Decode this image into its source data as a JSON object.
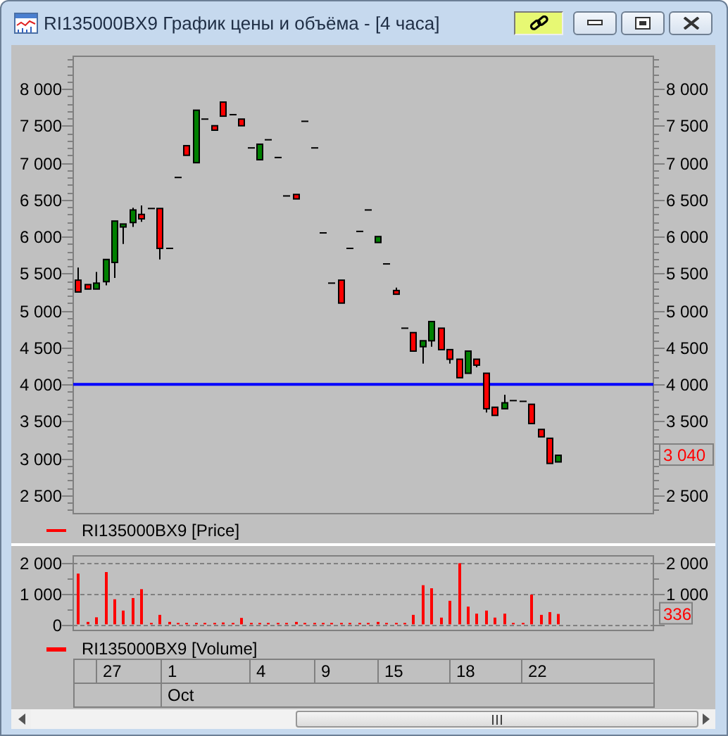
{
  "window": {
    "title": "RI135000BX9 График цены и объёма - [4 часа]"
  },
  "price_panel": {
    "legend": "RI135000BX9 [Price]",
    "last_value": "3 040",
    "chart_data": {
      "type": "candlestick",
      "categories": [
        null,
        null,
        null,
        null,
        null,
        null,
        null,
        null,
        null,
        null,
        null,
        null,
        null,
        null,
        null,
        null,
        null,
        null,
        null,
        null,
        null,
        null,
        null,
        null,
        null,
        null,
        null,
        null,
        null,
        null,
        null,
        null,
        null,
        null,
        null,
        null,
        null,
        null,
        null,
        null,
        null,
        null,
        null,
        null,
        null,
        null,
        null,
        null,
        null,
        null,
        null,
        null,
        null,
        null,
        null,
        null,
        null,
        null,
        null,
        null,
        null,
        null,
        null,
        null
      ],
      "ylim": [
        2250,
        8440
      ],
      "yticks": [
        {
          "value": 2500,
          "label": "2 500"
        },
        {
          "value": 3000,
          "label": "3 000"
        },
        {
          "value": 3500,
          "label": "3 500"
        },
        {
          "value": 4000,
          "label": "4 000"
        },
        {
          "value": 4500,
          "label": "4 500"
        },
        {
          "value": 5000,
          "label": "5 000"
        },
        {
          "value": 5500,
          "label": "5 500"
        },
        {
          "value": 6000,
          "label": "6 000"
        },
        {
          "value": 6500,
          "label": "6 500"
        },
        {
          "value": 7000,
          "label": "7 000"
        },
        {
          "value": 7500,
          "label": "7 500"
        },
        {
          "value": 8000,
          "label": "8 000"
        }
      ],
      "ohlc": [
        [
          5410,
          5580,
          5250,
          5250
        ],
        [
          5350,
          5350,
          5290,
          5290
        ],
        [
          5290,
          5520,
          5290,
          5370
        ],
        [
          5390,
          5690,
          5340,
          5690
        ],
        [
          5650,
          6210,
          5440,
          6210
        ],
        [
          6130,
          6170,
          5900,
          6170
        ],
        [
          6190,
          6390,
          6130,
          6360
        ],
        [
          6300,
          6420,
          6200,
          6240
        ],
        [
          6380,
          6380,
          6380,
          6380
        ],
        [
          6380,
          6380,
          5690,
          5840
        ],
        [
          5840,
          5840,
          5840,
          5840
        ],
        [
          6800,
          6800,
          6800,
          6800
        ],
        [
          7230,
          7230,
          7100,
          7100
        ],
        [
          7000,
          7710,
          7000,
          7710
        ],
        [
          7590,
          7590,
          7590,
          7590
        ],
        [
          7500,
          7500,
          7440,
          7440
        ],
        [
          7820,
          7820,
          7630,
          7630
        ],
        [
          7650,
          7650,
          7650,
          7650
        ],
        [
          7590,
          7590,
          7500,
          7500
        ],
        [
          7200,
          7200,
          7200,
          7200
        ],
        [
          7040,
          7250,
          7040,
          7250
        ],
        [
          7310,
          7310,
          7310,
          7310
        ],
        [
          7070,
          7070,
          7070,
          7070
        ],
        [
          6550,
          6550,
          6550,
          6550
        ],
        [
          6570,
          6570,
          6510,
          6510
        ],
        [
          7560,
          7560,
          7560,
          7560
        ],
        [
          7200,
          7200,
          7200,
          7200
        ],
        [
          6050,
          6050,
          6050,
          6050
        ],
        [
          5370,
          5370,
          5370,
          5370
        ],
        [
          5410,
          5410,
          5100,
          5100
        ],
        [
          5840,
          5840,
          5840,
          5840
        ],
        [
          6070,
          6070,
          6070,
          6070
        ],
        [
          6360,
          6360,
          6360,
          6360
        ],
        [
          5920,
          6000,
          5920,
          6000
        ],
        [
          5630,
          5630,
          5630,
          5630
        ],
        [
          5270,
          5310,
          5220,
          5220
        ],
        [
          4760,
          4760,
          4760,
          4760
        ],
        [
          4700,
          4700,
          4450,
          4450
        ],
        [
          4510,
          4590,
          4280,
          4590
        ],
        [
          4590,
          4850,
          4510,
          4850
        ],
        [
          4760,
          4760,
          4470,
          4470
        ],
        [
          4470,
          4470,
          4280,
          4340
        ],
        [
          4340,
          4340,
          4090,
          4090
        ],
        [
          4150,
          4450,
          4150,
          4450
        ],
        [
          4340,
          4340,
          4230,
          4260
        ],
        [
          4150,
          4150,
          3620,
          3670
        ],
        [
          3690,
          3690,
          3580,
          3580
        ],
        [
          3670,
          3860,
          3670,
          3750
        ],
        [
          3780,
          3780,
          3780,
          3780
        ],
        [
          3770,
          3770,
          3770,
          3770
        ],
        [
          3730,
          3730,
          3470,
          3470
        ],
        [
          3390,
          3390,
          3290,
          3290
        ],
        [
          3270,
          3270,
          2930,
          2930
        ],
        [
          2950,
          3040,
          2950,
          3040
        ],
        null,
        null,
        null,
        null,
        null,
        null,
        null,
        null,
        null,
        null
      ],
      "ref_lines": [
        {
          "axis": "y",
          "value": 4000,
          "color": "#0000ff"
        }
      ]
    }
  },
  "volume_panel": {
    "last_value": "336",
    "chart_data": {
      "type": "bar",
      "categories": [
        null,
        null,
        null,
        null,
        null,
        null,
        null,
        null,
        null,
        null,
        null,
        null,
        null,
        null,
        null,
        null,
        null,
        null,
        null,
        null,
        null,
        null,
        null,
        null,
        null,
        null,
        null,
        null,
        null,
        null,
        null,
        null,
        null,
        null,
        null,
        null,
        null,
        null,
        null,
        null,
        null,
        null,
        null,
        null,
        null,
        null,
        null,
        null,
        null,
        null,
        null,
        null,
        null,
        null,
        null,
        null,
        null,
        null,
        null,
        null,
        null,
        null,
        null,
        null
      ],
      "ylim": [
        -200,
        2240
      ],
      "grid": true,
      "yticks": [
        {
          "value": 0,
          "label": "0"
        },
        {
          "value": 1000,
          "label": "1 000"
        },
        {
          "value": 2000,
          "label": "2 000"
        }
      ],
      "series": [
        {
          "name": "RI135000BX9 [Volume]",
          "color": "#ff0000",
          "values": [
            1660,
            80,
            230,
            1710,
            820,
            450,
            860,
            1150,
            40,
            310,
            80,
            40,
            40,
            40,
            40,
            40,
            60,
            40,
            210,
            40,
            40,
            40,
            40,
            40,
            80,
            40,
            40,
            40,
            40,
            40,
            40,
            40,
            40,
            80,
            40,
            40,
            40,
            310,
            1280,
            1180,
            220,
            770,
            2000,
            580,
            350,
            450,
            220,
            350,
            40,
            40,
            970,
            310,
            400,
            340,
            null,
            null,
            null,
            null,
            null,
            null,
            null,
            null,
            null,
            null
          ]
        }
      ]
    }
  },
  "time_axis": {
    "days": [
      "27",
      "1",
      "4",
      "9",
      "15",
      "18",
      "22"
    ],
    "months": [
      "Oct"
    ]
  }
}
